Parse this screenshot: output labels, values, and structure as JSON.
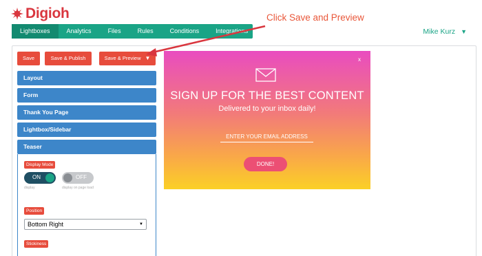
{
  "brand": {
    "name": "Digioh",
    "color": "#d9363e"
  },
  "nav": {
    "items": [
      {
        "label": "Lightboxes",
        "active": true
      },
      {
        "label": "Analytics"
      },
      {
        "label": "Files"
      },
      {
        "label": "Rules"
      },
      {
        "label": "Conditions"
      },
      {
        "label": "Integrations"
      }
    ],
    "color": "#1aa486"
  },
  "user": {
    "name": "Mike Kurz",
    "caret": "▼"
  },
  "annotation": {
    "text": "Click Save and Preview",
    "color": "#e9573a"
  },
  "toolbar": {
    "save_label": "Save",
    "save_publish_label": "Save & Publish",
    "save_preview_label": "Save & Preview",
    "dropdown_caret": "▼"
  },
  "sidebar": {
    "sections": [
      "Layout",
      "Form",
      "Thank You Page",
      "Lightbox/Sidebar",
      "Teaser"
    ],
    "teaser": {
      "display_mode_label": "Display Mode",
      "toggle_on_label": "ON",
      "toggle_off_label": "OFF",
      "sub_on": "display",
      "sub_off": "display on page load",
      "position_label": "Position",
      "position_value": "Bottom Right",
      "stickiness_label": "Stickiness"
    }
  },
  "popup": {
    "close": "x",
    "headline": "SIGN UP FOR THE BEST CONTENT",
    "subline": "Delivered to your inbox daily!",
    "email_placeholder": "ENTER YOUR EMAIL ADDRESS",
    "button_label": "DONE!",
    "gradient_top": "#e94cc0",
    "gradient_bottom": "#fbd026"
  },
  "icons": [
    "digioh-logo-icon",
    "envelope-icon",
    "close-icon",
    "chevron-down-icon"
  ]
}
